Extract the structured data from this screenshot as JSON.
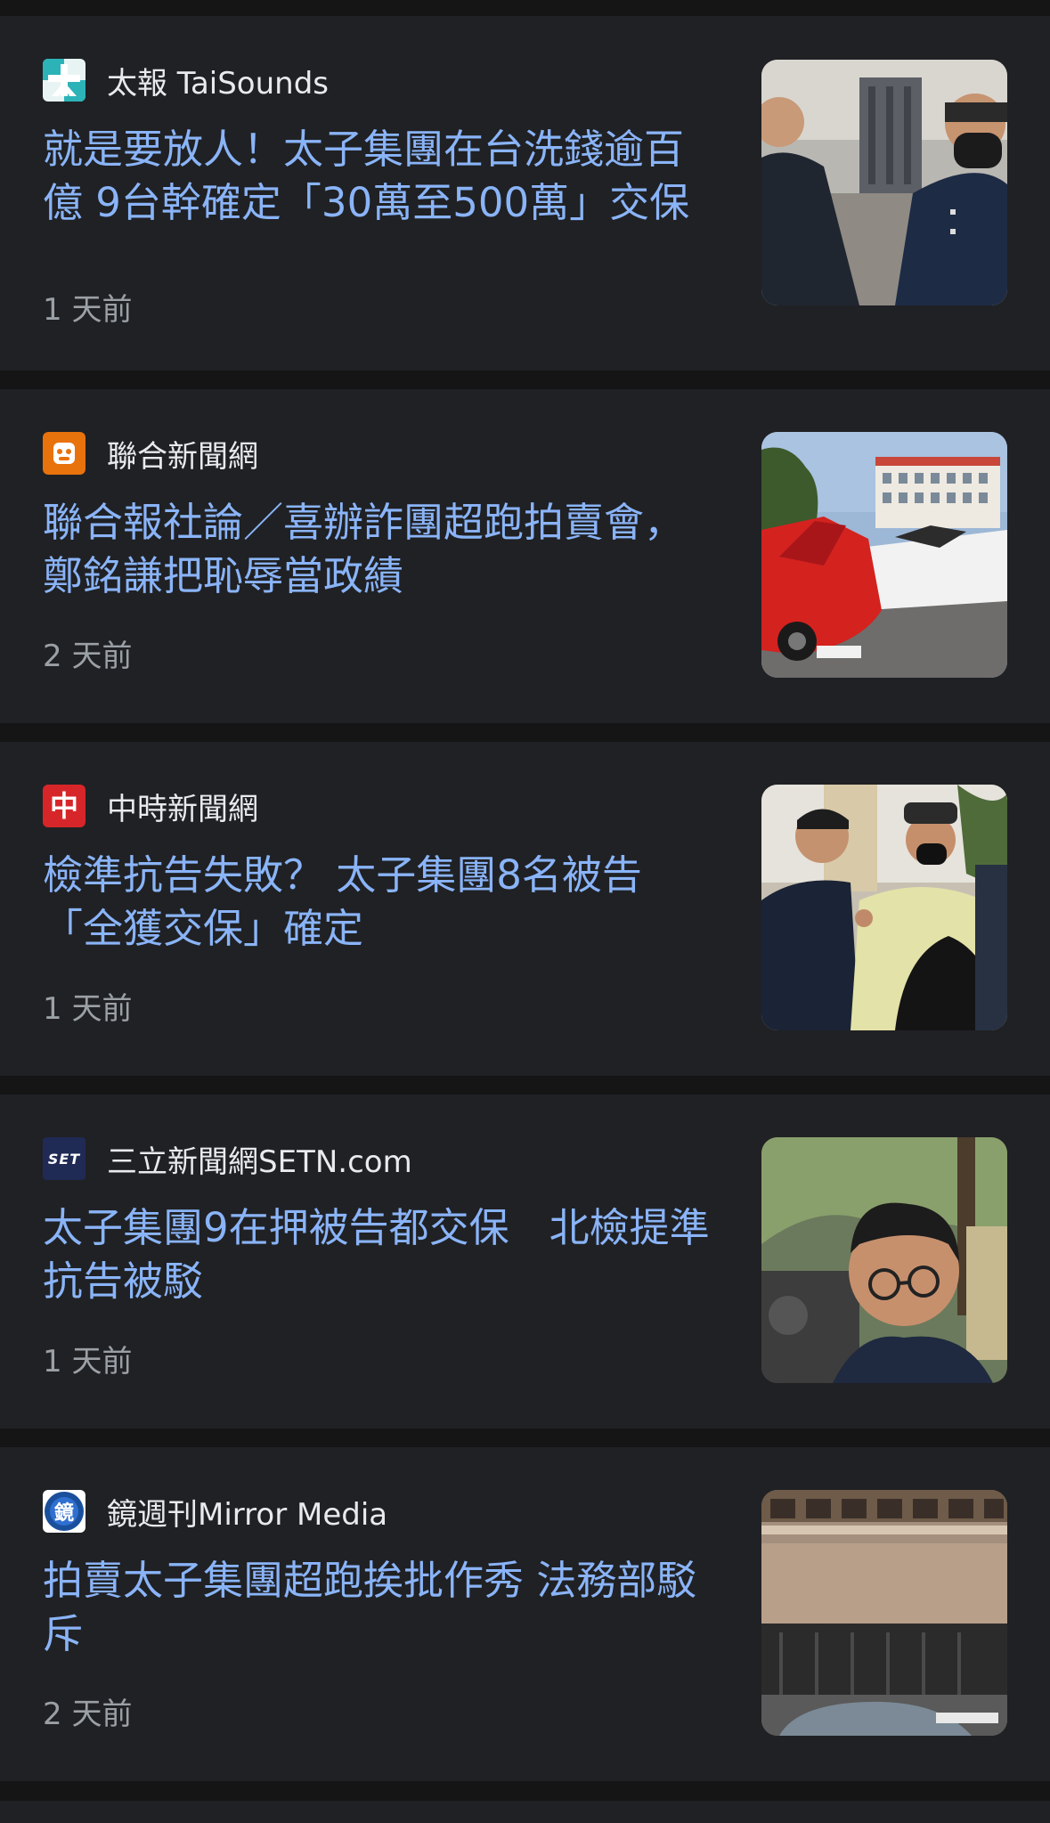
{
  "articles": [
    {
      "source": "太報 TaiSounds",
      "headline": "就是要放人！太子集團在台洗錢逾百億 9台幹確定「30萬至500萬」交保",
      "time": "1 天前"
    },
    {
      "source": "聯合新聞網",
      "headline": "聯合報社論／喜辦詐團超跑拍賣會，鄭銘謙把恥辱當政績",
      "time": "2 天前"
    },
    {
      "source": "中時新聞網",
      "headline": "檢準抗告失敗？ 太子集團8名被告「全獲交保」確定",
      "logo_text": "中",
      "time": "1 天前"
    },
    {
      "source": "三立新聞網SETN.com",
      "headline": "太子集團9在押被告都交保　北檢提準抗告被駁",
      "logo_text": "SET",
      "time": "1 天前"
    },
    {
      "source": "鏡週刊Mirror Media",
      "headline": "拍賣太子集團超跑挨批作秀 法務部駁斥",
      "logo_text": "鏡",
      "time": "2 天前"
    }
  ],
  "icons": {
    "taisounds_logo": "taisounds-logo-icon",
    "udn_logo": "udn-logo-icon",
    "chinatimes_logo": "chinatimes-logo-icon",
    "setn_logo": "setn-logo-icon",
    "mirror_logo": "mirror-media-logo-icon"
  },
  "colors": {
    "background": "#151515",
    "card": "#202124",
    "headline": "#8ab4f8",
    "source": "#e8eaed",
    "time": "#9aa0a6"
  }
}
